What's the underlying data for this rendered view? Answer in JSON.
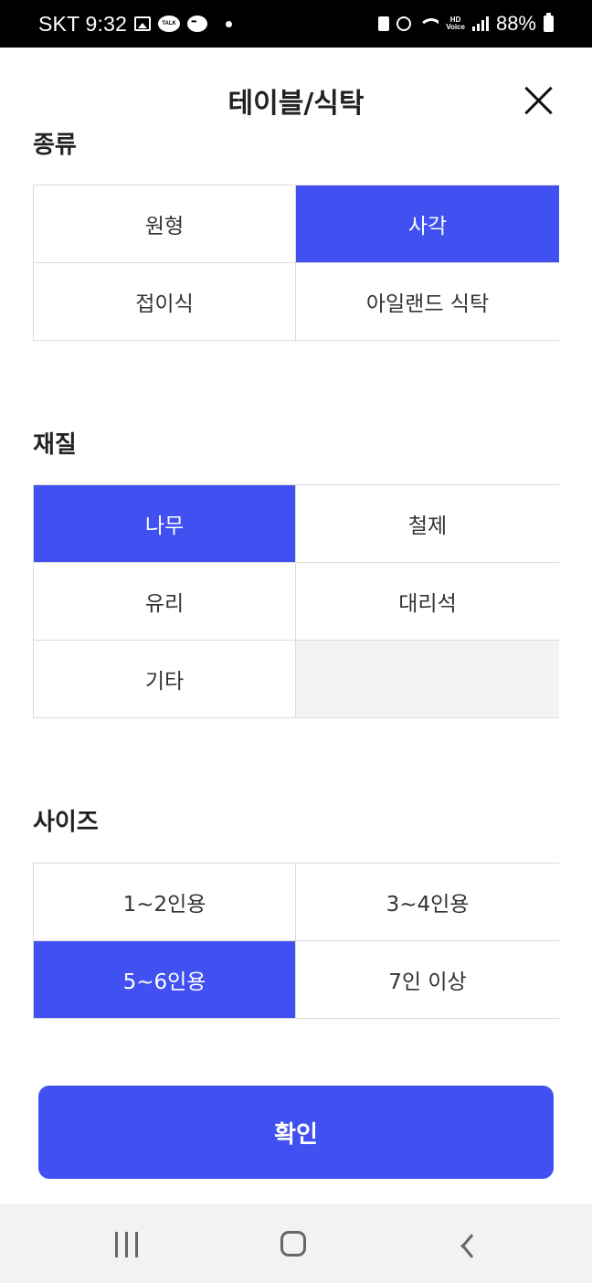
{
  "status_bar": {
    "carrier_time": "SKT 9:32",
    "talk_label": "TALK",
    "hd_voice_label": "HD\nVoice",
    "battery": "88%"
  },
  "header": {
    "title": "테이블/식탁"
  },
  "sections": [
    {
      "title": "종류",
      "options": [
        {
          "label": "원형",
          "selected": false
        },
        {
          "label": "사각",
          "selected": true
        },
        {
          "label": "접이식",
          "selected": false
        },
        {
          "label": "아일랜드 식탁",
          "selected": false
        }
      ]
    },
    {
      "title": "재질",
      "options": [
        {
          "label": "나무",
          "selected": true
        },
        {
          "label": "철제",
          "selected": false
        },
        {
          "label": "유리",
          "selected": false
        },
        {
          "label": "대리석",
          "selected": false
        },
        {
          "label": "기타",
          "selected": false
        }
      ]
    },
    {
      "title": "사이즈",
      "options": [
        {
          "label": "1~2인용",
          "selected": false
        },
        {
          "label": "3~4인용",
          "selected": false
        },
        {
          "label": "5~6인용",
          "selected": true
        },
        {
          "label": "7인 이상",
          "selected": false
        }
      ]
    }
  ],
  "confirm": {
    "label": "확인"
  },
  "colors": {
    "accent": "#4150f0",
    "border": "#dcdcdc",
    "empty_cell": "#f3f3f3"
  },
  "icons": {
    "close": "close-icon",
    "nav_recents": "recents-icon",
    "nav_home": "home-icon",
    "nav_back": "back-icon"
  }
}
